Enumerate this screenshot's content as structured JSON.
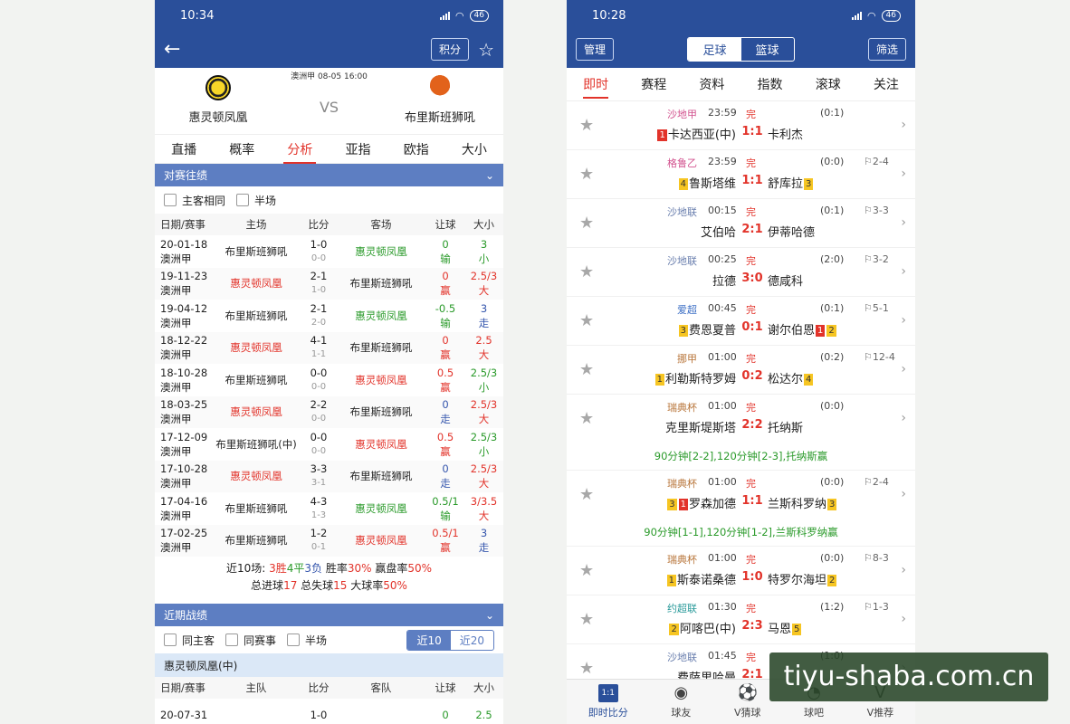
{
  "left": {
    "status_time": "10:34",
    "battery": "46",
    "nav": {
      "points_label": "积分"
    },
    "match": {
      "info": "澳洲甲 08-05 16:00",
      "home": "惠灵顿凤凰",
      "away": "布里斯班狮吼",
      "vs": "VS"
    },
    "tabs": [
      "直播",
      "概率",
      "分析",
      "亚指",
      "欧指",
      "大小"
    ],
    "h2h": {
      "title": "对赛往绩",
      "filters": [
        "主客相同",
        "半场"
      ],
      "headers": [
        "日期/赛事",
        "主场",
        "比分",
        "客场",
        "让球",
        "大小"
      ],
      "rows": [
        [
          "20-01-18",
          "澳洲甲",
          "布里斯班狮吼",
          "1-0",
          "0-0",
          "惠灵顿凤凰",
          "0",
          "输",
          "3",
          "小"
        ],
        [
          "19-11-23",
          "澳洲甲",
          "惠灵顿凤凰",
          "2-1",
          "1-0",
          "布里斯班狮吼",
          "0",
          "赢",
          "2.5/3",
          "大"
        ],
        [
          "19-04-12",
          "澳洲甲",
          "布里斯班狮吼",
          "2-1",
          "2-0",
          "惠灵顿凤凰",
          "-0.5",
          "输",
          "3",
          "走"
        ],
        [
          "18-12-22",
          "澳洲甲",
          "惠灵顿凤凰",
          "4-1",
          "1-1",
          "布里斯班狮吼",
          "0",
          "赢",
          "2.5",
          "大"
        ],
        [
          "18-10-28",
          "澳洲甲",
          "布里斯班狮吼",
          "0-0",
          "0-0",
          "惠灵顿凤凰",
          "0.5",
          "赢",
          "2.5/3",
          "小"
        ],
        [
          "18-03-25",
          "澳洲甲",
          "惠灵顿凤凰",
          "2-2",
          "0-0",
          "布里斯班狮吼",
          "0",
          "走",
          "2.5/3",
          "大"
        ],
        [
          "17-12-09",
          "澳洲甲",
          "布里斯班狮吼(中)",
          "0-0",
          "0-0",
          "惠灵顿凤凰",
          "0.5",
          "赢",
          "2.5/3",
          "小"
        ],
        [
          "17-10-28",
          "澳洲甲",
          "惠灵顿凤凰",
          "3-3",
          "3-1",
          "布里斯班狮吼",
          "0",
          "走",
          "2.5/3",
          "大"
        ],
        [
          "17-04-16",
          "澳洲甲",
          "布里斯班狮吼",
          "4-3",
          "1-3",
          "惠灵顿凤凰",
          "0.5/1",
          "输",
          "3/3.5",
          "大"
        ],
        [
          "17-02-25",
          "澳洲甲",
          "布里斯班狮吼",
          "1-2",
          "0-1",
          "惠灵顿凤凰",
          "0.5/1",
          "赢",
          "3",
          "走"
        ]
      ],
      "summary_line1_pre": "近10场: ",
      "wins": "3胜",
      "draws": "4平",
      "losses": "3负",
      "win_rate_label": " 胜率",
      "win_rate": "30%",
      "handicap_label": " 赢盘率",
      "handicap_rate": "50%",
      "goals_for_label": "总进球",
      "goals_for": "17",
      "goals_against_label": " 总失球",
      "goals_against": "15",
      "big_rate_label": " 大球率",
      "big_rate": "50%"
    },
    "recent": {
      "title": "近期战绩",
      "filters": [
        "同主客",
        "同赛事",
        "半场"
      ],
      "seg": [
        "近10",
        "近20"
      ],
      "team_band": "惠灵顿凤凰(中)",
      "headers": [
        "日期/赛事",
        "主队",
        "比分",
        "客队",
        "让球",
        "大小"
      ],
      "first_row": [
        "20-07-31",
        "1-0",
        "0",
        "2.5"
      ]
    }
  },
  "right": {
    "status_time": "10:28",
    "battery": "46",
    "nav": {
      "manage_label": "管理",
      "seg": [
        "足球",
        "篮球"
      ],
      "filter_label": "筛选"
    },
    "tabs": [
      "即时",
      "赛程",
      "资料",
      "指数",
      "滚球",
      "关注"
    ],
    "matches": [
      {
        "league": "沙地甲",
        "league_color": "pink",
        "time": "23:59",
        "status": "完",
        "half": "(0:1)",
        "corner": "",
        "home_cards": [
          [
            "r",
            "1"
          ]
        ],
        "home": "卡达西亚(中)",
        "score": "1:1",
        "away": "卡利杰",
        "away_cards": [],
        "note": ""
      },
      {
        "league": "格鲁乙",
        "league_color": "pink",
        "time": "23:59",
        "status": "完",
        "half": "(0:0)",
        "corner": "⚐2-4",
        "home_cards": [
          [
            "y",
            "4"
          ]
        ],
        "home": "鲁斯塔维",
        "score": "1:1",
        "away": "舒库拉",
        "away_cards": [
          [
            "y",
            "3"
          ]
        ],
        "note": ""
      },
      {
        "league": "沙地联",
        "league_color": "grey",
        "time": "00:15",
        "status": "完",
        "half": "(0:1)",
        "corner": "⚐3-3",
        "home_cards": [],
        "home": "艾伯哈",
        "score": "2:1",
        "away": "伊蒂哈德",
        "away_cards": [],
        "note": ""
      },
      {
        "league": "沙地联",
        "league_color": "grey",
        "time": "00:25",
        "status": "完",
        "half": "(2:0)",
        "corner": "⚐3-2",
        "home_cards": [],
        "home": "拉德",
        "score": "3:0",
        "away": "德咸科",
        "away_cards": [],
        "note": ""
      },
      {
        "league": "爱超",
        "league_color": "blue",
        "time": "00:45",
        "status": "完",
        "half": "(0:1)",
        "corner": "⚐5-1",
        "home_cards": [
          [
            "y",
            "3"
          ]
        ],
        "home": "费恩夏普",
        "score": "0:1",
        "away": "谢尔伯恩",
        "away_cards": [
          [
            "r",
            "1"
          ],
          [
            "y",
            "2"
          ]
        ],
        "note": ""
      },
      {
        "league": "挪甲",
        "league_color": "brown",
        "time": "01:00",
        "status": "完",
        "half": "(0:2)",
        "corner": "⚐12-4",
        "home_cards": [
          [
            "y",
            "1"
          ]
        ],
        "home": "利勒斯特罗姆",
        "score": "0:2",
        "away": "松达尔",
        "away_cards": [
          [
            "y",
            "4"
          ]
        ],
        "note": ""
      },
      {
        "league": "瑞典杯",
        "league_color": "brown",
        "time": "01:00",
        "status": "完",
        "half": "(0:0)",
        "corner": "",
        "home_cards": [],
        "home": "克里斯堤斯塔",
        "score": "2:2",
        "away": "托纳斯",
        "away_cards": [],
        "note": "90分钟[2-2],120分钟[2-3],托纳斯赢"
      },
      {
        "league": "瑞典杯",
        "league_color": "brown",
        "time": "01:00",
        "status": "完",
        "half": "(0:0)",
        "corner": "⚐2-4",
        "home_cards": [
          [
            "y",
            "3"
          ],
          [
            "r",
            "1"
          ]
        ],
        "home": "罗森加德",
        "score": "1:1",
        "away": "兰斯科罗纳",
        "away_cards": [
          [
            "y",
            "3"
          ]
        ],
        "note": "90分钟[1-1],120分钟[1-2],兰斯科罗纳赢"
      },
      {
        "league": "瑞典杯",
        "league_color": "brown",
        "time": "01:00",
        "status": "完",
        "half": "(0:0)",
        "corner": "⚐8-3",
        "home_cards": [
          [
            "y",
            "1"
          ]
        ],
        "home": "斯泰诺桑德",
        "score": "1:0",
        "away": "特罗尔海坦",
        "away_cards": [
          [
            "y",
            "2"
          ]
        ],
        "note": ""
      },
      {
        "league": "约超联",
        "league_color": "teal",
        "time": "01:30",
        "status": "完",
        "half": "(1:2)",
        "corner": "⚐1-3",
        "home_cards": [
          [
            "y",
            "2"
          ]
        ],
        "home": "阿喀巴(中)",
        "score": "2:3",
        "away": "马恩",
        "away_cards": [
          [
            "y",
            "5"
          ]
        ],
        "note": ""
      },
      {
        "league": "沙地联",
        "league_color": "grey",
        "time": "01:45",
        "status": "完",
        "half": "(1:0)",
        "corner": "",
        "home_cards": [],
        "home": "费萨里哈曼",
        "score": "2:1",
        "away": "",
        "away_cards": [],
        "note": ""
      }
    ],
    "bottom_nav": [
      {
        "label": "即时比分",
        "icon": "calendar-icon",
        "glyph": "1:1"
      },
      {
        "label": "球友",
        "icon": "soccer-ball-icon",
        "glyph": "◉"
      },
      {
        "label": "V猜球",
        "icon": "soccer-ball-icon",
        "glyph": "⚽"
      },
      {
        "label": "球吧",
        "icon": "chat-bubble-icon",
        "glyph": "◔"
      },
      {
        "label": "V推荐",
        "icon": "v-recommend-icon",
        "glyph": "V"
      }
    ]
  },
  "watermark": "tiyu-shaba.com.cn",
  "colors": {
    "header_blue": "#2a4f9a",
    "accent_red": "#e2332a",
    "section_blue": "#5d7ec2"
  }
}
